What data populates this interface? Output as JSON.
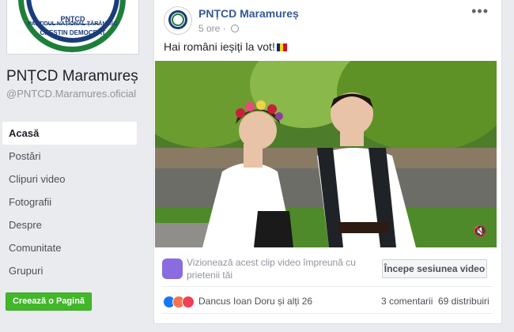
{
  "sidebar": {
    "logo": {
      "top_text": "PARTIDUL NAȚIONAL ȚĂRĂNESC",
      "mid_text": "CREȘTIN DEMOCRAT"
    },
    "page_name": "PNȚCD Maramureș",
    "handle": "@PNTCD.Maramures.oficial",
    "nav": [
      "Acasă",
      "Postări",
      "Clipuri video",
      "Fotografii",
      "Despre",
      "Comunitate",
      "Grupuri"
    ],
    "active_nav": "Acasă",
    "create_page": "Creează o Pagină"
  },
  "post": {
    "author": "PNȚCD Maramureș",
    "time": "5 ore",
    "separator": "·",
    "message": "Hai români ieșiți la vot!",
    "more_icon": "more-options-icon",
    "watch_text": "Vizionează acest clip video împreună cu prietenii tăi",
    "session_button": "Începe sesiunea video",
    "reaction_names": "Dancus Ioan Doru și alți 26",
    "comments": "3 comentarii",
    "shares": "69 distribuiri",
    "colors": {
      "link": "#365899",
      "watch_purple": "#8a6be0",
      "green_button": "#42b72a",
      "flag": [
        "#002b7f",
        "#fcd116",
        "#ce1126"
      ],
      "like": "#1877f2",
      "angry": "#f7714c",
      "love": "#f33e58"
    }
  }
}
